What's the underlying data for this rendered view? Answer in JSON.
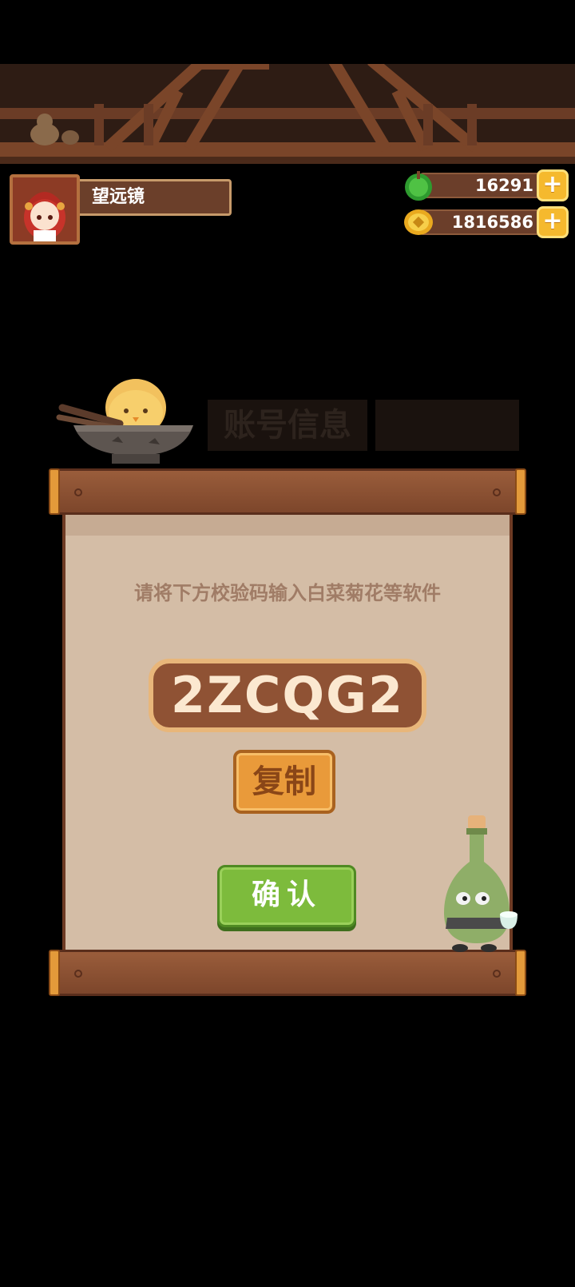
{
  "player": {
    "name": "望远镜"
  },
  "currencies": {
    "gems": {
      "amount": "16291",
      "icon": "green-gem-icon"
    },
    "coins": {
      "amount": "1816586",
      "icon": "gold-coin-icon"
    },
    "plus_symbol": "+"
  },
  "background_tabs": {
    "account_info": "账号信息",
    "other_tab": ""
  },
  "dialog": {
    "instruction": "请将下方校验码输入白菜菊花等软件",
    "verification_code": "2ZCQG2",
    "copy_label": "复制",
    "confirm_label": "确认"
  },
  "colors": {
    "background": "#000000",
    "paper": "#d4bda6",
    "wood": "#8f5234",
    "confirm_green": "#7dbb3c",
    "copy_orange": "#e99a3a",
    "gold": "#f5b92e"
  }
}
